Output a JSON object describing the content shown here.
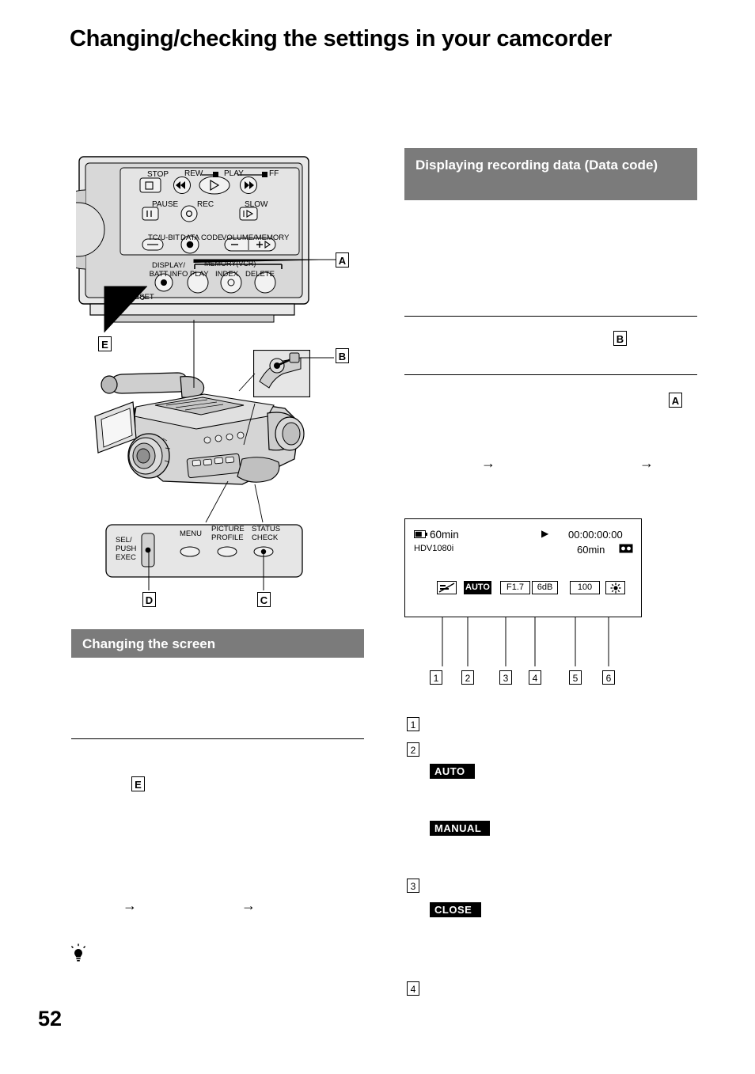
{
  "page": {
    "number": "52",
    "title": "Changing/checking the settings in your camcorder"
  },
  "sections": {
    "data_code": "Displaying recording data (Data code)",
    "changing_screen": "Changing the screen"
  },
  "callouts": {
    "a": "A",
    "b": "B",
    "c": "C",
    "d": "D",
    "e": "E"
  },
  "numbers": {
    "n1": "1",
    "n2": "2",
    "n3": "3",
    "n4": "4",
    "n5": "5",
    "n6": "6"
  },
  "arrow": "→",
  "remote": {
    "stop": "STOP",
    "rew": "REW",
    "play": "PLAY",
    "ff": "FF",
    "pause": "PAUSE",
    "rec": "REC",
    "slow": "SLOW",
    "tc_ubit": "TC/U-BIT",
    "data_code": "DATA CODE",
    "volume_memory": "VOLUME/MEMORY",
    "display_batt_info": "DISPLAY/\nBATT INFO",
    "display_line1": "DISPLAY/",
    "display_line2": "BATT INFO",
    "memory_vcr": "MEMORY(VCR)",
    "mem_play": "PLAY",
    "mem_index": "INDEX",
    "mem_delete": "DELETE",
    "reset": "RESET"
  },
  "body_panel": {
    "sel_push_exec_1": "SEL/",
    "sel_push_exec_2": "PUSH",
    "sel_push_exec_3": "EXEC",
    "menu": "MENU",
    "picture_profile_1": "PICTURE",
    "picture_profile_2": "PROFILE",
    "status_check_1": "STATUS",
    "status_check_2": "CHECK"
  },
  "lcd": {
    "battery_time": "60min",
    "format": "HDV1080i",
    "play_symbol": "▶",
    "timecode": "00:00:00:00",
    "remaining": "60min",
    "chip_auto": "AUTO",
    "chip_aperture": "F1.7",
    "chip_gain": "6dB",
    "chip_shutter": "100",
    "tape_icon": "tape-icon",
    "wb_icon": "white-balance-icon",
    "steady_icon": "steadyshot-off-icon"
  },
  "inline_terms": {
    "auto": "AUTO",
    "manual": "MANUAL",
    "close": "CLOSE"
  }
}
